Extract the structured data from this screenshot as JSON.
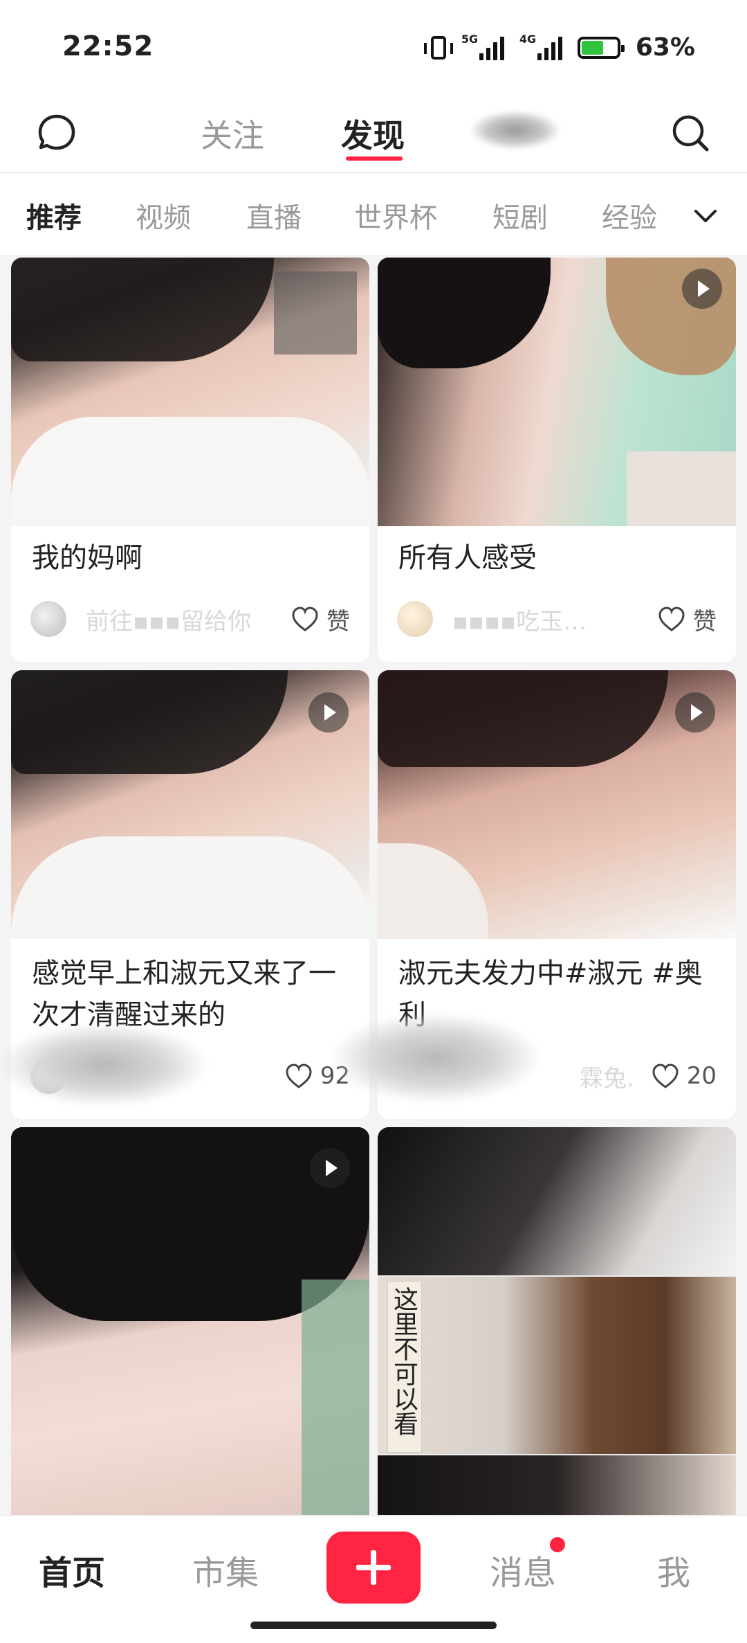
{
  "status_bar": {
    "time": "22:52",
    "network_1": "5G",
    "network_2": "4G",
    "battery_percent": "63%",
    "battery_level": 0.63
  },
  "top_nav": {
    "tabs": [
      {
        "label": "关注",
        "active": false
      },
      {
        "label": "发现",
        "active": true
      }
    ]
  },
  "categories": {
    "items": [
      "推荐",
      "视频",
      "直播",
      "世界杯",
      "短剧",
      "经验"
    ],
    "active": "推荐"
  },
  "feed": {
    "cards": [
      {
        "title": "我的妈啊",
        "author": "前往▪▪▪留给你",
        "likes": "赞",
        "video": false
      },
      {
        "title": "所有人感受",
        "author": "▪▪▪▪吃玉…",
        "likes": "赞",
        "video": true
      },
      {
        "title": "感觉早上和淑元又来了一次才清醒过来的",
        "author": "",
        "likes": "92",
        "video": true
      },
      {
        "title": "淑元夫发力中#淑元 #奥利",
        "author": "霖兔.",
        "likes": "20",
        "video": true
      },
      {
        "title": "",
        "author": "",
        "likes": "",
        "video": true
      },
      {
        "title": "",
        "author": "",
        "likes": "",
        "video": false,
        "overlay_text": "这里不可以看"
      }
    ]
  },
  "bottom_nav": {
    "home": "首页",
    "market": "市集",
    "messages": "消息",
    "me": "我"
  },
  "colors": {
    "accent": "#ff2442",
    "text_primary": "#222222",
    "text_secondary": "#999999",
    "feed_background": "#f4f4f4"
  },
  "icons": [
    "chat-bubble-icon",
    "search-icon",
    "chevron-down-icon",
    "heart-icon",
    "play-icon",
    "plus-icon"
  ]
}
